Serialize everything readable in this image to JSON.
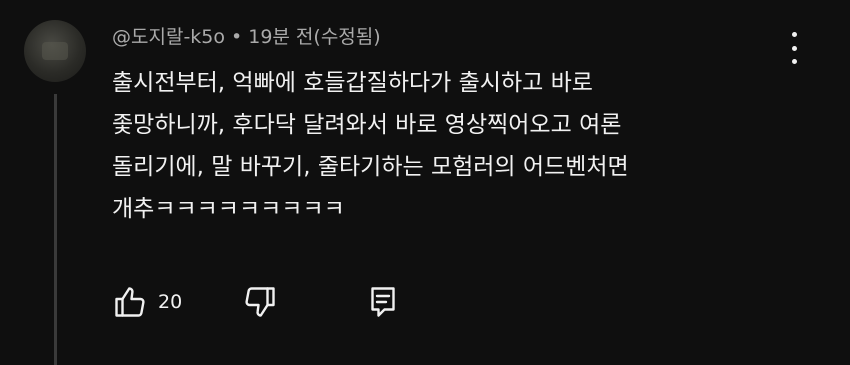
{
  "comment": {
    "author": "@도지랄-k5o",
    "separator": "•",
    "timestamp": "19분 전(수정됨)",
    "lines": [
      "출시전부터, 억빠에 호들갑질하다가 출시하고 바로",
      "좇망하니까, 후다닥 달려와서 바로 영상찍어오고 여론",
      "돌리기에, 말 바꾸기, 줄타기하는 모험러의 어드벤처면",
      "개추ㅋㅋㅋㅋㅋㅋㅋㅋㅋ"
    ]
  },
  "actions": {
    "like_count": "20",
    "like_icon": "thumbs-up-icon",
    "dislike_icon": "thumbs-down-icon",
    "reply_icon": "reply-comment-icon"
  },
  "menu": {
    "icon": "more-vertical-icon"
  },
  "colors": {
    "background": "#0f0f0f",
    "text_primary": "#f1f1f1",
    "text_secondary": "#aaaaaa",
    "thread_line": "#3a3a3a"
  }
}
